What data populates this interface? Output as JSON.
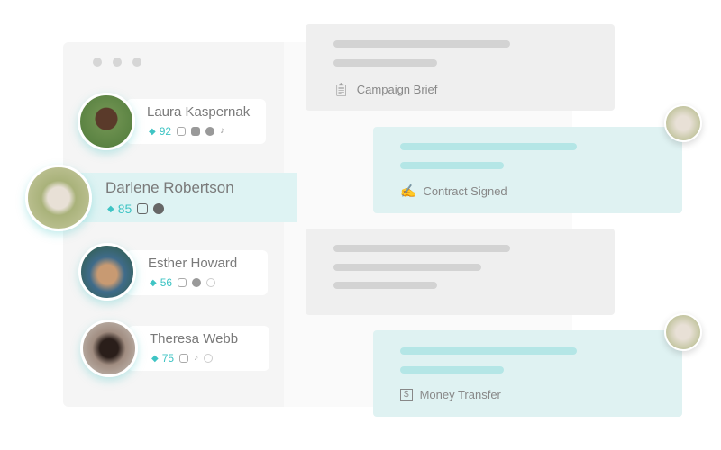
{
  "influencers": [
    {
      "name": "Laura Kaspernak",
      "score": "92",
      "socials": [
        "instagram",
        "youtube",
        "facebook",
        "tiktok"
      ]
    },
    {
      "name": "Darlene Robertson",
      "score": "85",
      "socials": [
        "instagram",
        "facebook"
      ]
    },
    {
      "name": "Esther Howard",
      "score": "56",
      "socials": [
        "instagram",
        "facebook",
        "plus"
      ]
    },
    {
      "name": "Theresa Webb",
      "score": "75",
      "socials": [
        "instagram",
        "tiktok",
        "plus"
      ]
    }
  ],
  "steps": [
    {
      "label": "Campaign Brief",
      "icon": "clipboard-icon"
    },
    {
      "label": "Contract Signed",
      "icon": "contract-icon"
    },
    {
      "label": "",
      "icon": ""
    },
    {
      "label": "Money Transfer",
      "icon": "dollar-icon"
    }
  ],
  "colors": {
    "accent": "#3fc4c4",
    "selected": "#def3f3"
  }
}
